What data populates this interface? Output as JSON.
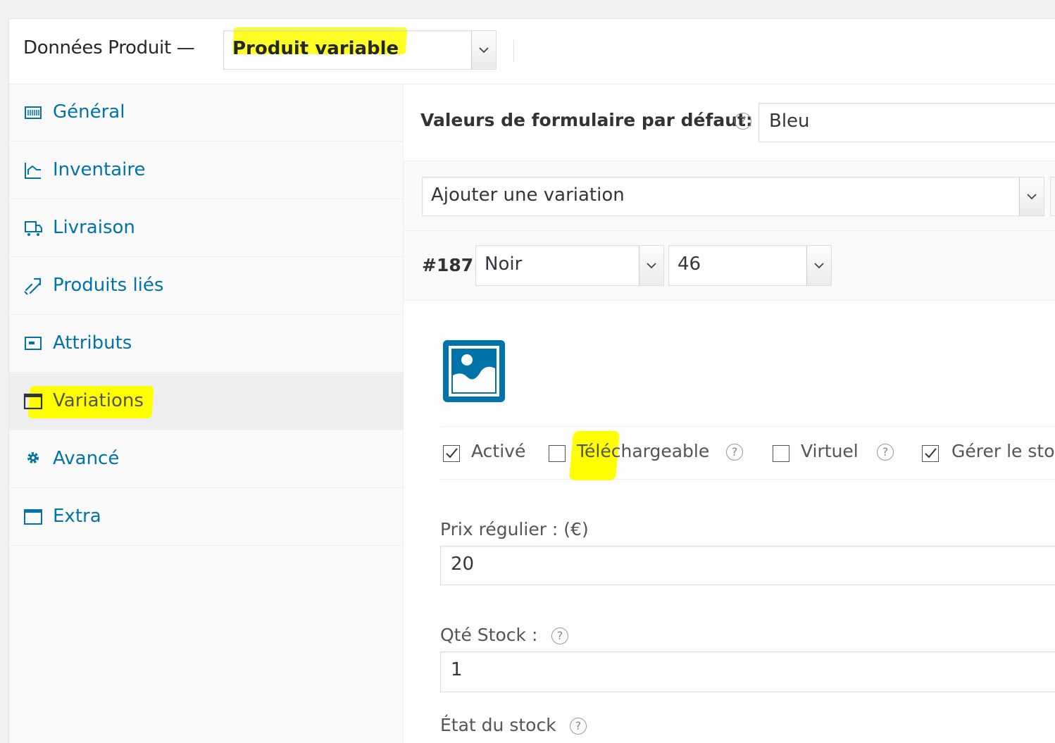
{
  "header": {
    "title": "Données Produit —",
    "product_type": "Produit variable"
  },
  "sidebar": {
    "items": [
      {
        "label": "Général",
        "icon": "general-icon"
      },
      {
        "label": "Inventaire",
        "icon": "inventory-icon"
      },
      {
        "label": "Livraison",
        "icon": "shipping-icon"
      },
      {
        "label": "Produits liés",
        "icon": "link-icon"
      },
      {
        "label": "Attributs",
        "icon": "attributes-icon"
      },
      {
        "label": "Variations",
        "icon": "variations-icon"
      },
      {
        "label": "Avancé",
        "icon": "gear-icon"
      },
      {
        "label": "Extra",
        "icon": "window-icon"
      }
    ],
    "active": "Variations"
  },
  "main": {
    "default_form_label": "Valeurs de formulaire par défaut:",
    "default_form_value": "Bleu",
    "add_variation": "Ajouter une variation",
    "variation": {
      "id": "#187:",
      "attr1": "Noir",
      "attr2": "46"
    },
    "options": {
      "active": "Activé",
      "downloadable": "Téléchargeable",
      "virtual": "Virtuel",
      "manage_stock": "Gérer le stoc"
    },
    "regular_price_label": "Prix régulier : (€)",
    "regular_price_value": "20",
    "stock_qty_label": "Qté Stock :",
    "stock_qty_value": "1",
    "stock_status_label": "État du stock"
  },
  "colors": {
    "link": "#0073aa",
    "highlight": "#ffff00"
  }
}
